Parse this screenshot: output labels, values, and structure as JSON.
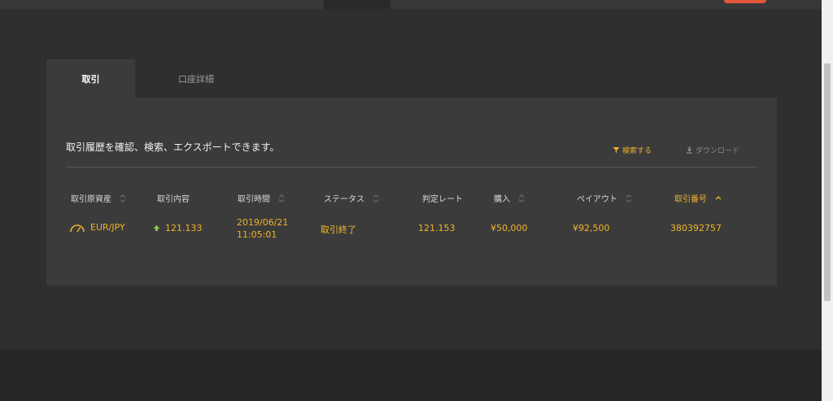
{
  "tabs": [
    {
      "label": "取引",
      "active": true
    },
    {
      "label": "口座詳細",
      "active": false
    }
  ],
  "panel": {
    "description": "取引履歴を確認、検索、エクスポートできます。",
    "search_label": "検索する",
    "download_label": "ダウンロード"
  },
  "table": {
    "headers": [
      "取引原資産",
      "取引内容",
      "取引時間",
      "ステータス",
      "判定レート",
      "購入",
      "ペイアウト",
      "取引番号"
    ],
    "rows": [
      {
        "asset": "EUR/JPY",
        "direction_rate": "121.133",
        "date": "2019/06/21",
        "time": "11:05:01",
        "status": "取引終了",
        "judgment_rate": "121.153",
        "purchase": "¥50,000",
        "payout": "¥92,500",
        "trade_id": "380392757"
      }
    ]
  },
  "colors": {
    "accent": "#f0b429",
    "panel_bg": "#3b3b3b",
    "page_bg": "#2f2f2f",
    "up_arrow": "#8bc34a",
    "top_accent": "#e4583a"
  }
}
